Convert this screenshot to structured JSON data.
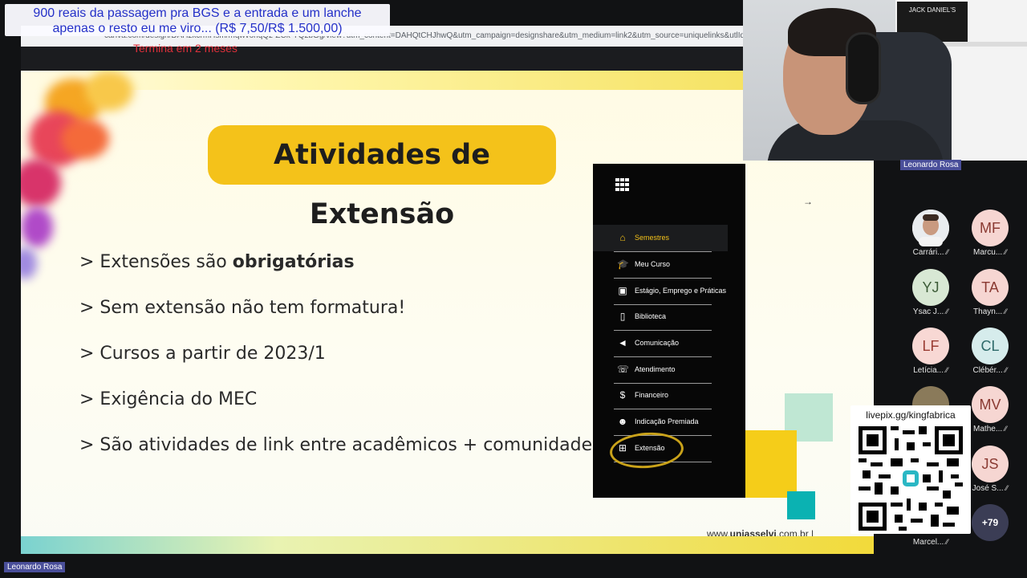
{
  "browser": {
    "url": "canva.com/design/DAHzkcrmHsm/mqwvohqQz-ZCk-YQzbGg/view?utm_content=DAHQtCHJhwQ&utm_campaign=designshare&utm_medium=link2&utm_source=uniquelinks&utlId="
  },
  "donation": {
    "line1": "900 reais da passagem pra BGS e a entrada e um lanche",
    "line2": "apenas o resto eu me viro... (R$ 7,50/R$ 1.500,00)",
    "timer": "Termina em 2 meses"
  },
  "slide": {
    "title": "Atividades de Extensão",
    "bullets": [
      {
        "prefix": "> Extensões são ",
        "bold": "obrigatórias"
      },
      {
        "prefix": "> Sem extensão não tem formatura!",
        "bold": ""
      },
      {
        "prefix": "> Cursos a partir de 2023/1",
        "bold": ""
      },
      {
        "prefix": "> Exigência do MEC",
        "bold": ""
      },
      {
        "prefix": "> São atividades de link entre acadêmicos + comunidade",
        "bold": ""
      }
    ],
    "site_prefix": "www.",
    "site_bold": "uniasselvi",
    "site_suffix": ".com.br  |",
    "arrow": "→"
  },
  "menu": {
    "items": [
      {
        "label": "Semestres",
        "icon": "house-icon"
      },
      {
        "label": "Meu Curso",
        "icon": "graduation-cap-icon"
      },
      {
        "label": "Estágio, Emprego e Práticas",
        "icon": "briefcase-icon"
      },
      {
        "label": "Biblioteca",
        "icon": "book-icon"
      },
      {
        "label": "Comunicação",
        "icon": "megaphone-icon"
      },
      {
        "label": "Atendimento",
        "icon": "phone-icon"
      },
      {
        "label": "Financeiro",
        "icon": "dollar-icon"
      },
      {
        "label": "Indicação Premiada",
        "icon": "people-icon"
      },
      {
        "label": "Extensão",
        "icon": "extension-icon"
      }
    ],
    "active_index": 0,
    "accent": "#f4c21a"
  },
  "webcam": {
    "name": "Leonardo Rosa",
    "box_text": "JACK DANIEL'S"
  },
  "participants": [
    {
      "initials": "",
      "name": "Carrári...",
      "bg": "#e8e0d8",
      "fg": "#333333"
    },
    {
      "initials": "MF",
      "name": "Marcu...",
      "bg": "#f6d6d2",
      "fg": "#8a3a32"
    },
    {
      "initials": "YJ",
      "name": "Ysac J...",
      "bg": "#d8e8d4",
      "fg": "#3b5a36"
    },
    {
      "initials": "TA",
      "name": "Thayn...",
      "bg": "#f6d6d2",
      "fg": "#8a3a32"
    },
    {
      "initials": "LF",
      "name": "Letícia...",
      "bg": "#f8d8d4",
      "fg": "#9a3d33"
    },
    {
      "initials": "CL",
      "name": "Clébér...",
      "bg": "#d6ecec",
      "fg": "#2e6a6a"
    },
    {
      "initials": "",
      "name": "",
      "bg": "#8a7a5a",
      "fg": "#ffffff"
    },
    {
      "initials": "MV",
      "name": "Mathe...",
      "bg": "#f6d6d2",
      "fg": "#8a3a32"
    },
    {
      "initials": "JS",
      "name": "José S...",
      "bg": "#f6d6d2",
      "fg": "#8a3a32"
    },
    {
      "initials": "",
      "name": "Marcel...",
      "bg": "#2a2a2a",
      "fg": "#ffffff"
    }
  ],
  "more_count": "+79",
  "qr": {
    "title": "livepix.gg/kingfabrica"
  },
  "footer_name": "Leonardo Rosa"
}
